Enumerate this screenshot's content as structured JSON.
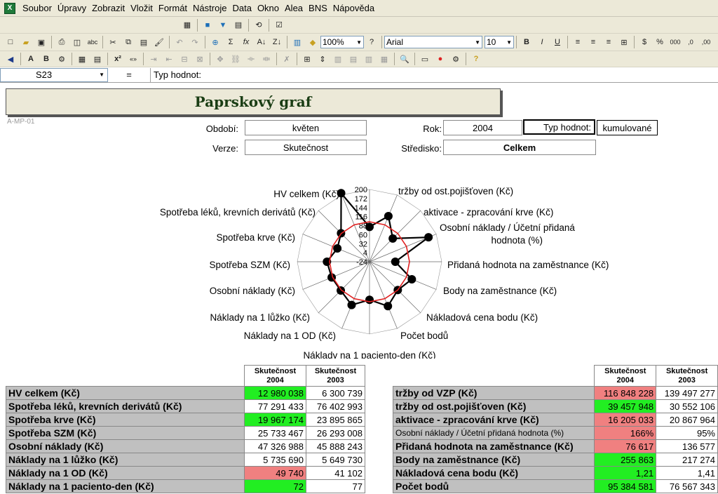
{
  "menu": {
    "items": [
      "Soubor",
      "Úpravy",
      "Zobrazit",
      "Vložit",
      "Formát",
      "Nástroje",
      "Data",
      "Okno",
      "Alea",
      "BNS",
      "Nápověda"
    ]
  },
  "toolbar": {
    "zoom": "100%",
    "font_name": "Arial",
    "font_size": "10"
  },
  "formula_bar": {
    "cell_ref": "S23",
    "eq": "=",
    "content": "Typ hodnot:"
  },
  "sheet": {
    "title": "Paprskový graf",
    "code": "A-MP-01",
    "obdobi_label": "Období:",
    "obdobi_value": "květen",
    "rok_label": "Rok:",
    "rok_value": "2004",
    "typ_label": "Typ hodnot:",
    "typ_value": "kumulované",
    "verze_label": "Verze:",
    "verze_value": "Skutečnost",
    "stredisko_label": "Středisko:",
    "stredisko_value": "Celkem"
  },
  "colors": {
    "green": "#22ee22",
    "red": "#f08080",
    "title": "#1a3d14"
  },
  "chart_data": {
    "type": "radar",
    "ticks": [
      "200",
      "172",
      "144",
      "116",
      "88",
      "60",
      "32",
      "4",
      "-24"
    ],
    "axes": [
      "tržby od VZP (Kč)",
      "tržby od ost.pojišťoven (Kč)",
      "aktivace - zpracování krve (Kč)",
      "Osobní náklady / Účetní přidaná hodnota (%)",
      "Přidaná hodnota na zaměstnance (Kč)",
      "Body na zaměstnance (Kč)",
      "Nákladová cena bodu (Kč)",
      "Počet bodů",
      "Náklady na 1 paciento-den (Kč)",
      "Náklady na 1 OD (Kč)",
      "Náklady na 1 lůžko (Kč)",
      "Osobní náklady (Kč)",
      "Spotřeba SZM (Kč)",
      "Spotřeba krve (Kč)",
      "Spotřeba léků, krevních derivátů (Kč)",
      "HV celkem (Kč)"
    ],
    "range": [
      -24,
      200
    ],
    "series": [
      {
        "values": [
          84,
          129,
          78,
          174,
          56,
          118,
          100,
          125,
          94,
          121,
          102,
          103,
          108,
          84,
          101,
          206
        ]
      },
      {
        "values": [
          100,
          100,
          100,
          100,
          100,
          100,
          100,
          100,
          100,
          100,
          100,
          100,
          100,
          100,
          100,
          100
        ]
      }
    ]
  },
  "left_table": {
    "headers": [
      "Skutečnost\n2004",
      "Skutečnost\n2003"
    ],
    "rows": [
      {
        "label": "HV celkem (Kč)",
        "v2004": "12 980 038",
        "v2003": "6 300 739",
        "hl": "green"
      },
      {
        "label": "Spotřeba léků, krevních derivátů (Kč)",
        "v2004": "77 291 433",
        "v2003": "76 402 993",
        "hl": ""
      },
      {
        "label": "Spotřeba krve (Kč)",
        "v2004": "19 967 174",
        "v2003": "23 895 865",
        "hl": "green"
      },
      {
        "label": "Spotřeba SZM (Kč)",
        "v2004": "25 733 467",
        "v2003": "26 293 008",
        "hl": ""
      },
      {
        "label": "Osobní náklady (Kč)",
        "v2004": "47 326 988",
        "v2003": "45 888 243",
        "hl": ""
      },
      {
        "label": "Náklady na 1 lůžko (Kč)",
        "v2004": "5 735 690",
        "v2003": "5 649 730",
        "hl": ""
      },
      {
        "label": "Náklady na 1 OD (Kč)",
        "v2004": "49 740",
        "v2003": "41 102",
        "hl": "red"
      },
      {
        "label": "Náklady na 1 paciento-den (Kč)",
        "v2004": "72",
        "v2003": "77",
        "hl": "green"
      }
    ]
  },
  "right_table": {
    "headers": [
      "Skutečnost\n2004",
      "Skutečnost\n2003"
    ],
    "rows": [
      {
        "label": "tržby od VZP (Kč)",
        "v2004": "116 848 228",
        "v2003": "139 497 277",
        "hl": "red",
        "small": false
      },
      {
        "label": "tržby od ost.pojišťoven (Kč)",
        "v2004": "39 457 948",
        "v2003": "30 552 106",
        "hl": "green",
        "small": false
      },
      {
        "label": "aktivace - zpracování krve (Kč)",
        "v2004": "16 205 033",
        "v2003": "20 867 964",
        "hl": "red",
        "small": false
      },
      {
        "label": "Osobní náklady / Účetní přidaná hodnota (%)",
        "v2004": "166%",
        "v2003": "95%",
        "hl": "red",
        "small": true
      },
      {
        "label": "Přidaná hodnota na zaměstnance (Kč)",
        "v2004": "76 617",
        "v2003": "136 577",
        "hl": "red",
        "small": false
      },
      {
        "label": "Body na zaměstnance (Kč)",
        "v2004": "255 863",
        "v2003": "217 274",
        "hl": "green",
        "small": false
      },
      {
        "label": "Nákladová cena bodu (Kč)",
        "v2004": "1,21",
        "v2003": "1,41",
        "hl": "green",
        "small": false
      },
      {
        "label": "Počet bodů",
        "v2004": "95 384 581",
        "v2003": "76 567 343",
        "hl": "green",
        "small": false
      }
    ]
  }
}
